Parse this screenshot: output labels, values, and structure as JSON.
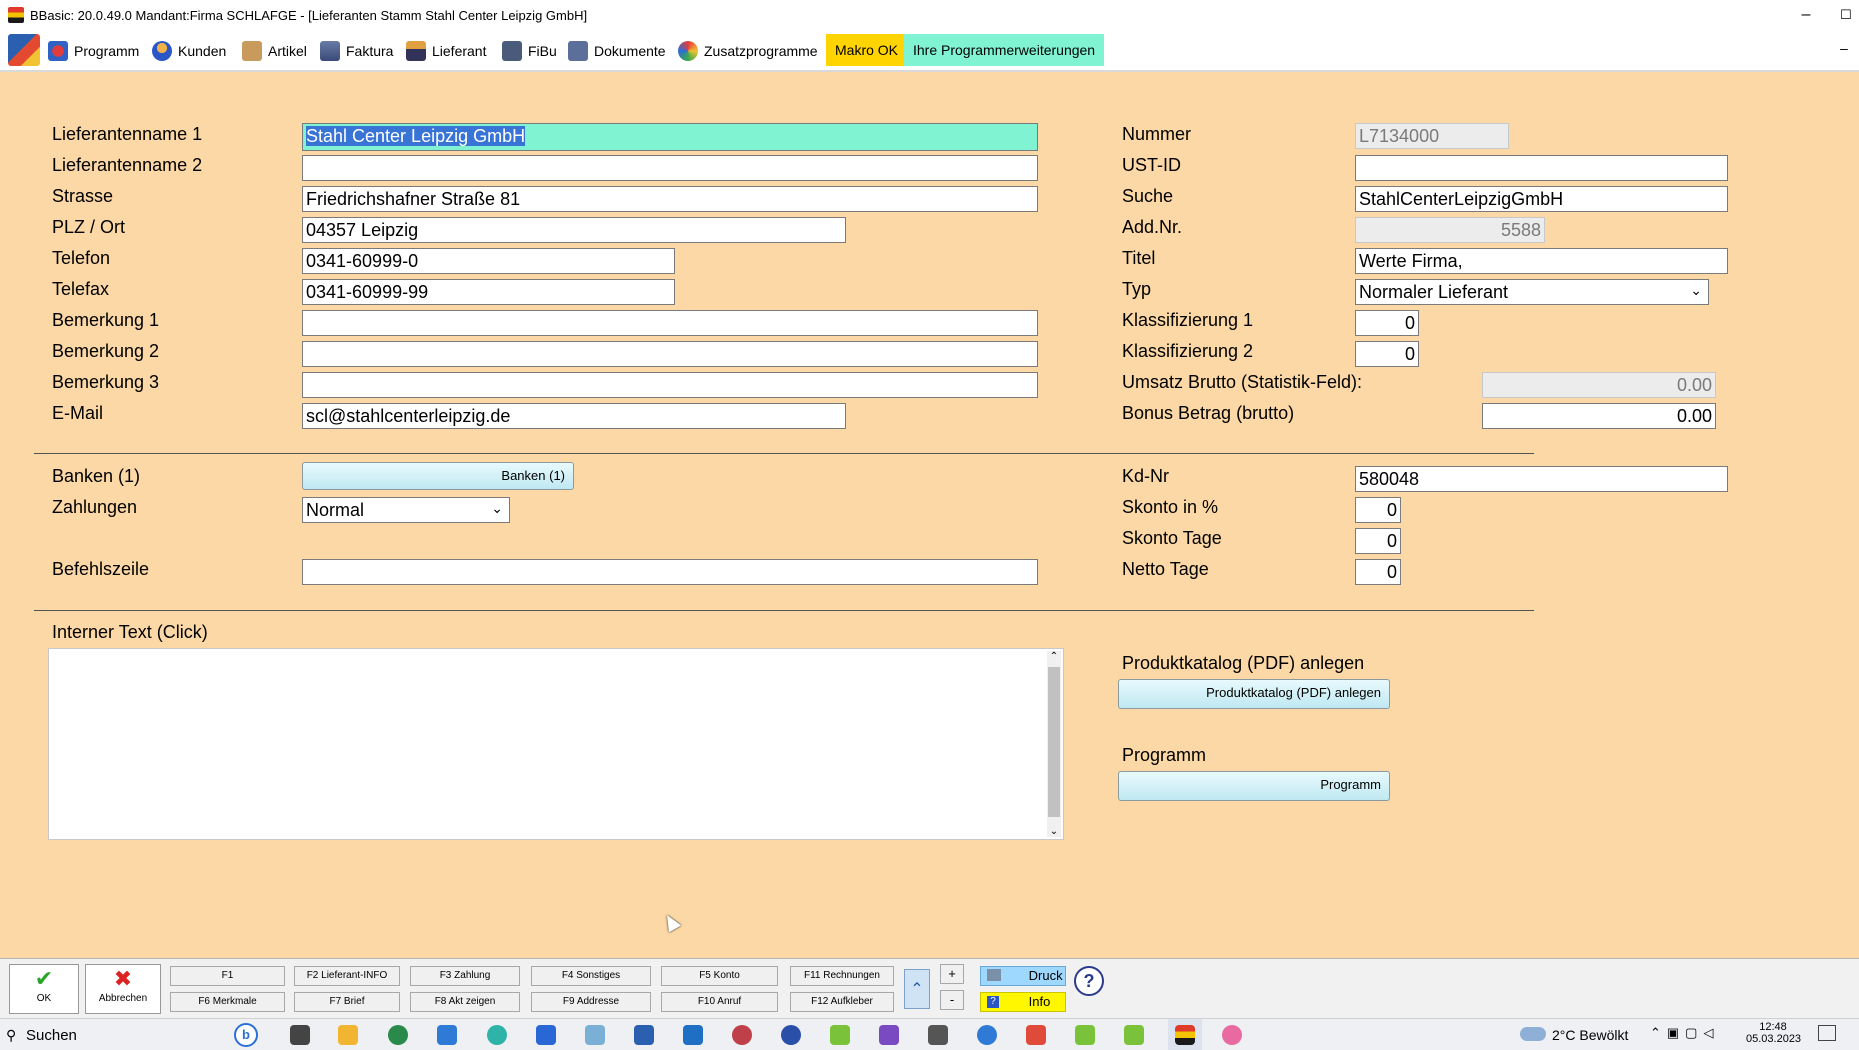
{
  "window": {
    "title": "BBasic: 20.0.49.0 Mandant:Firma SCHLAFGE - [Lieferanten Stamm Stahl Center Leipzig GmbH]",
    "minimize": "–",
    "maximize": "☐"
  },
  "menu": {
    "items": [
      "Programm",
      "Kunden",
      "Artikel",
      "Faktura",
      "Lieferant",
      "FiBu",
      "Dokumente",
      "Zusatzprogramme"
    ],
    "makro": "Makro OK",
    "extensions": "Ihre Programmerweiterungen",
    "dash": "–"
  },
  "form": {
    "left": {
      "lieferantenname1": {
        "label": "Lieferantenname 1",
        "value": "Stahl Center Leipzig GmbH"
      },
      "lieferantenname2": {
        "label": "Lieferantenname 2",
        "value": ""
      },
      "strasse": {
        "label": "Strasse",
        "value": "Friedrichshafner Straße 81"
      },
      "plzort": {
        "label": "PLZ / Ort",
        "value": "04357 Leipzig"
      },
      "telefon": {
        "label": "Telefon",
        "value": "0341-60999-0"
      },
      "telefax": {
        "label": "Telefax",
        "value": "0341-60999-99"
      },
      "bemerkung1": {
        "label": "Bemerkung 1",
        "value": ""
      },
      "bemerkung2": {
        "label": "Bemerkung 2",
        "value": ""
      },
      "bemerkung3": {
        "label": "Bemerkung 3",
        "value": ""
      },
      "email": {
        "label": "E-Mail",
        "value": "scl@stahlcenterleipzig.de"
      },
      "banken": {
        "label": "Banken (1)",
        "button": "Banken (1)"
      },
      "zahlungen": {
        "label": "Zahlungen",
        "value": "Normal"
      },
      "befehlszeile": {
        "label": "Befehlszeile",
        "value": ""
      }
    },
    "right": {
      "nummer": {
        "label": "Nummer",
        "value": "L7134000"
      },
      "ustid": {
        "label": "UST-ID",
        "value": ""
      },
      "suche": {
        "label": "Suche",
        "value": "StahlCenterLeipzigGmbH"
      },
      "addnr": {
        "label": "Add.Nr.",
        "value": "5588"
      },
      "titel": {
        "label": "Titel",
        "value": "Werte Firma,"
      },
      "typ": {
        "label": "Typ",
        "value": "Normaler Lieferant"
      },
      "klass1": {
        "label": "Klassifizierung 1",
        "value": "0"
      },
      "klass2": {
        "label": "Klassifizierung 2",
        "value": "0"
      },
      "umsatz": {
        "label": "Umsatz Brutto (Statistik-Feld):",
        "value": "0.00"
      },
      "bonus": {
        "label": "Bonus Betrag (brutto)",
        "value": "0.00"
      },
      "kdnr": {
        "label": "Kd-Nr",
        "value": "580048"
      },
      "skonto": {
        "label": "Skonto in %",
        "value": "0"
      },
      "skontotage": {
        "label": "Skonto Tage",
        "value": "0"
      },
      "nettotage": {
        "label": "Netto Tage",
        "value": "0"
      }
    },
    "internal_text": {
      "label": "Interner Text (Click)",
      "value": ""
    },
    "produktkatalog": {
      "label": "Produktkatalog (PDF) anlegen",
      "button": "Produktkatalog (PDF) anlegen"
    },
    "programm": {
      "label": "Programm",
      "button": "Programm"
    }
  },
  "toolbar": {
    "ok": "OK",
    "abbrechen": "Abbrechen",
    "fkeys_top": [
      "F1",
      "F2 Lieferant-INFO",
      "F3 Zahlung",
      "F4 Sonstiges",
      "F5 Konto",
      "F11 Rechnungen"
    ],
    "fkeys_bottom": [
      "F6 Merkmale",
      "F7 Brief",
      "F8 Akt zeigen",
      "F9 Addresse",
      "F10 Anruf",
      "F12 Aufkleber"
    ],
    "plus": "+",
    "minus": "-",
    "druck": "Druck",
    "info": "Info",
    "help": "?"
  },
  "taskbar": {
    "search": "Suchen",
    "weather": "2°C  Bewölkt",
    "time": "12:48",
    "date": "05.03.2023"
  }
}
